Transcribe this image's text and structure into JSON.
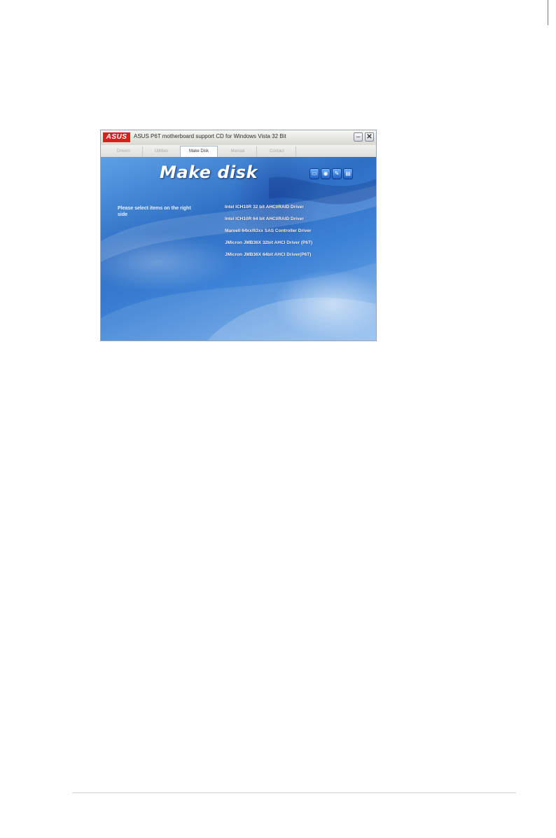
{
  "window": {
    "logo": "ASUS",
    "title": "ASUS P6T motherboard support CD for Windows Vista 32 Bit",
    "minimize_glyph": "–",
    "close_glyph": "✕"
  },
  "tabs": [
    {
      "label": "Drivers",
      "active": false
    },
    {
      "label": "Utilities",
      "active": false
    },
    {
      "label": "Make Disk",
      "active": true
    },
    {
      "label": "Manual",
      "active": false
    },
    {
      "label": "Contact",
      "active": false
    }
  ],
  "content": {
    "heading": "Make disk",
    "prompt": "Please select items on the right side",
    "items": [
      "Intel ICH10R 32 bit AHCI/RAID Driver",
      "Intel ICH10R 64 bit AHCI/RAID Driver",
      "Marvell 64xx/63xx SAS Controller Driver",
      "JMicron JMB36X 32bit AHCI Driver (P6T)",
      "JMicron JMB36X 64bit AHCI Driver(P6T)"
    ],
    "toolbar_icons": [
      "monitor-icon",
      "cd-icon",
      "wrench-icon",
      "document-icon"
    ],
    "colors": {
      "background": "#2f72c8",
      "accent_red": "#d6221f"
    }
  }
}
